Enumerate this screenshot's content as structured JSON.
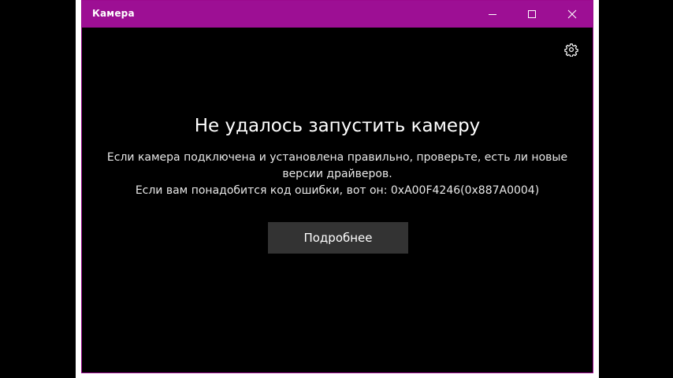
{
  "window": {
    "title": "Камера",
    "accent_color": "#9d0f94",
    "buttons": {
      "minimize": "minimize-icon",
      "maximize": "maximize-icon",
      "close": "close-icon",
      "settings": "gear-icon"
    }
  },
  "error": {
    "title": "Не удалось запустить камеру",
    "message_line1": "Если камера подключена и установлена правильно, проверьте, есть ли новые",
    "message_line2": "версии драйверов.",
    "message_line3": "Если вам понадобится код ошибки, вот он: 0xA00F4246(0x887A0004)",
    "button_label": "Подробнее"
  }
}
